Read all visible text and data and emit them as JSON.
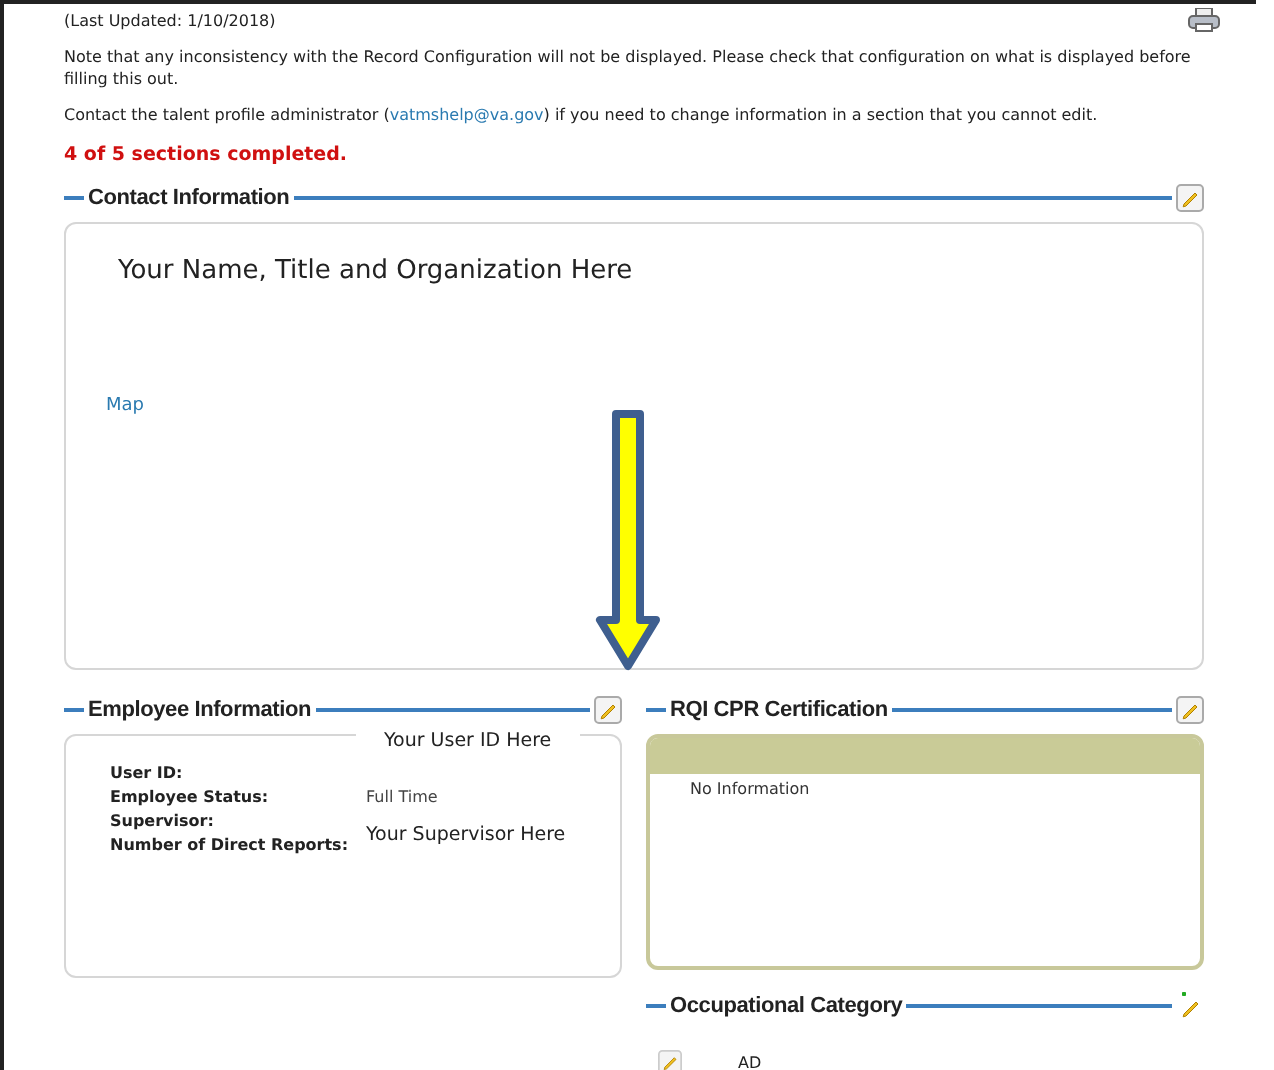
{
  "last_updated": "(Last Updated: 1/10/2018)",
  "note": "Note that any inconsistency with the Record Configuration will not be displayed. Please check that configuration on what is displayed before filling this out.",
  "contact": {
    "before": "Contact the talent profile administrator (",
    "email": "vatmshelp@va.gov",
    "after": ") if you need to change information in a section that you cannot edit."
  },
  "progress": "4 of 5 sections completed.",
  "contact_section": {
    "title": "Contact Information",
    "name_line": "Your Name, Title and Organization Here",
    "map_link": "Map"
  },
  "employee_section": {
    "title": "Employee Information",
    "user_id_overlay": "Your User ID Here",
    "fields": [
      {
        "label": "User ID:"
      },
      {
        "label": "Employee Status:",
        "value": "Full Time"
      },
      {
        "label": "Supervisor:"
      },
      {
        "label": "Number of Direct Reports:"
      }
    ],
    "supervisor_overlay": "Your Supervisor Here"
  },
  "rqi_section": {
    "title": "RQI CPR Certification",
    "empty_text": "No Information"
  },
  "occupational_section": {
    "title": "Occupational Category",
    "items": [
      "AD"
    ]
  }
}
